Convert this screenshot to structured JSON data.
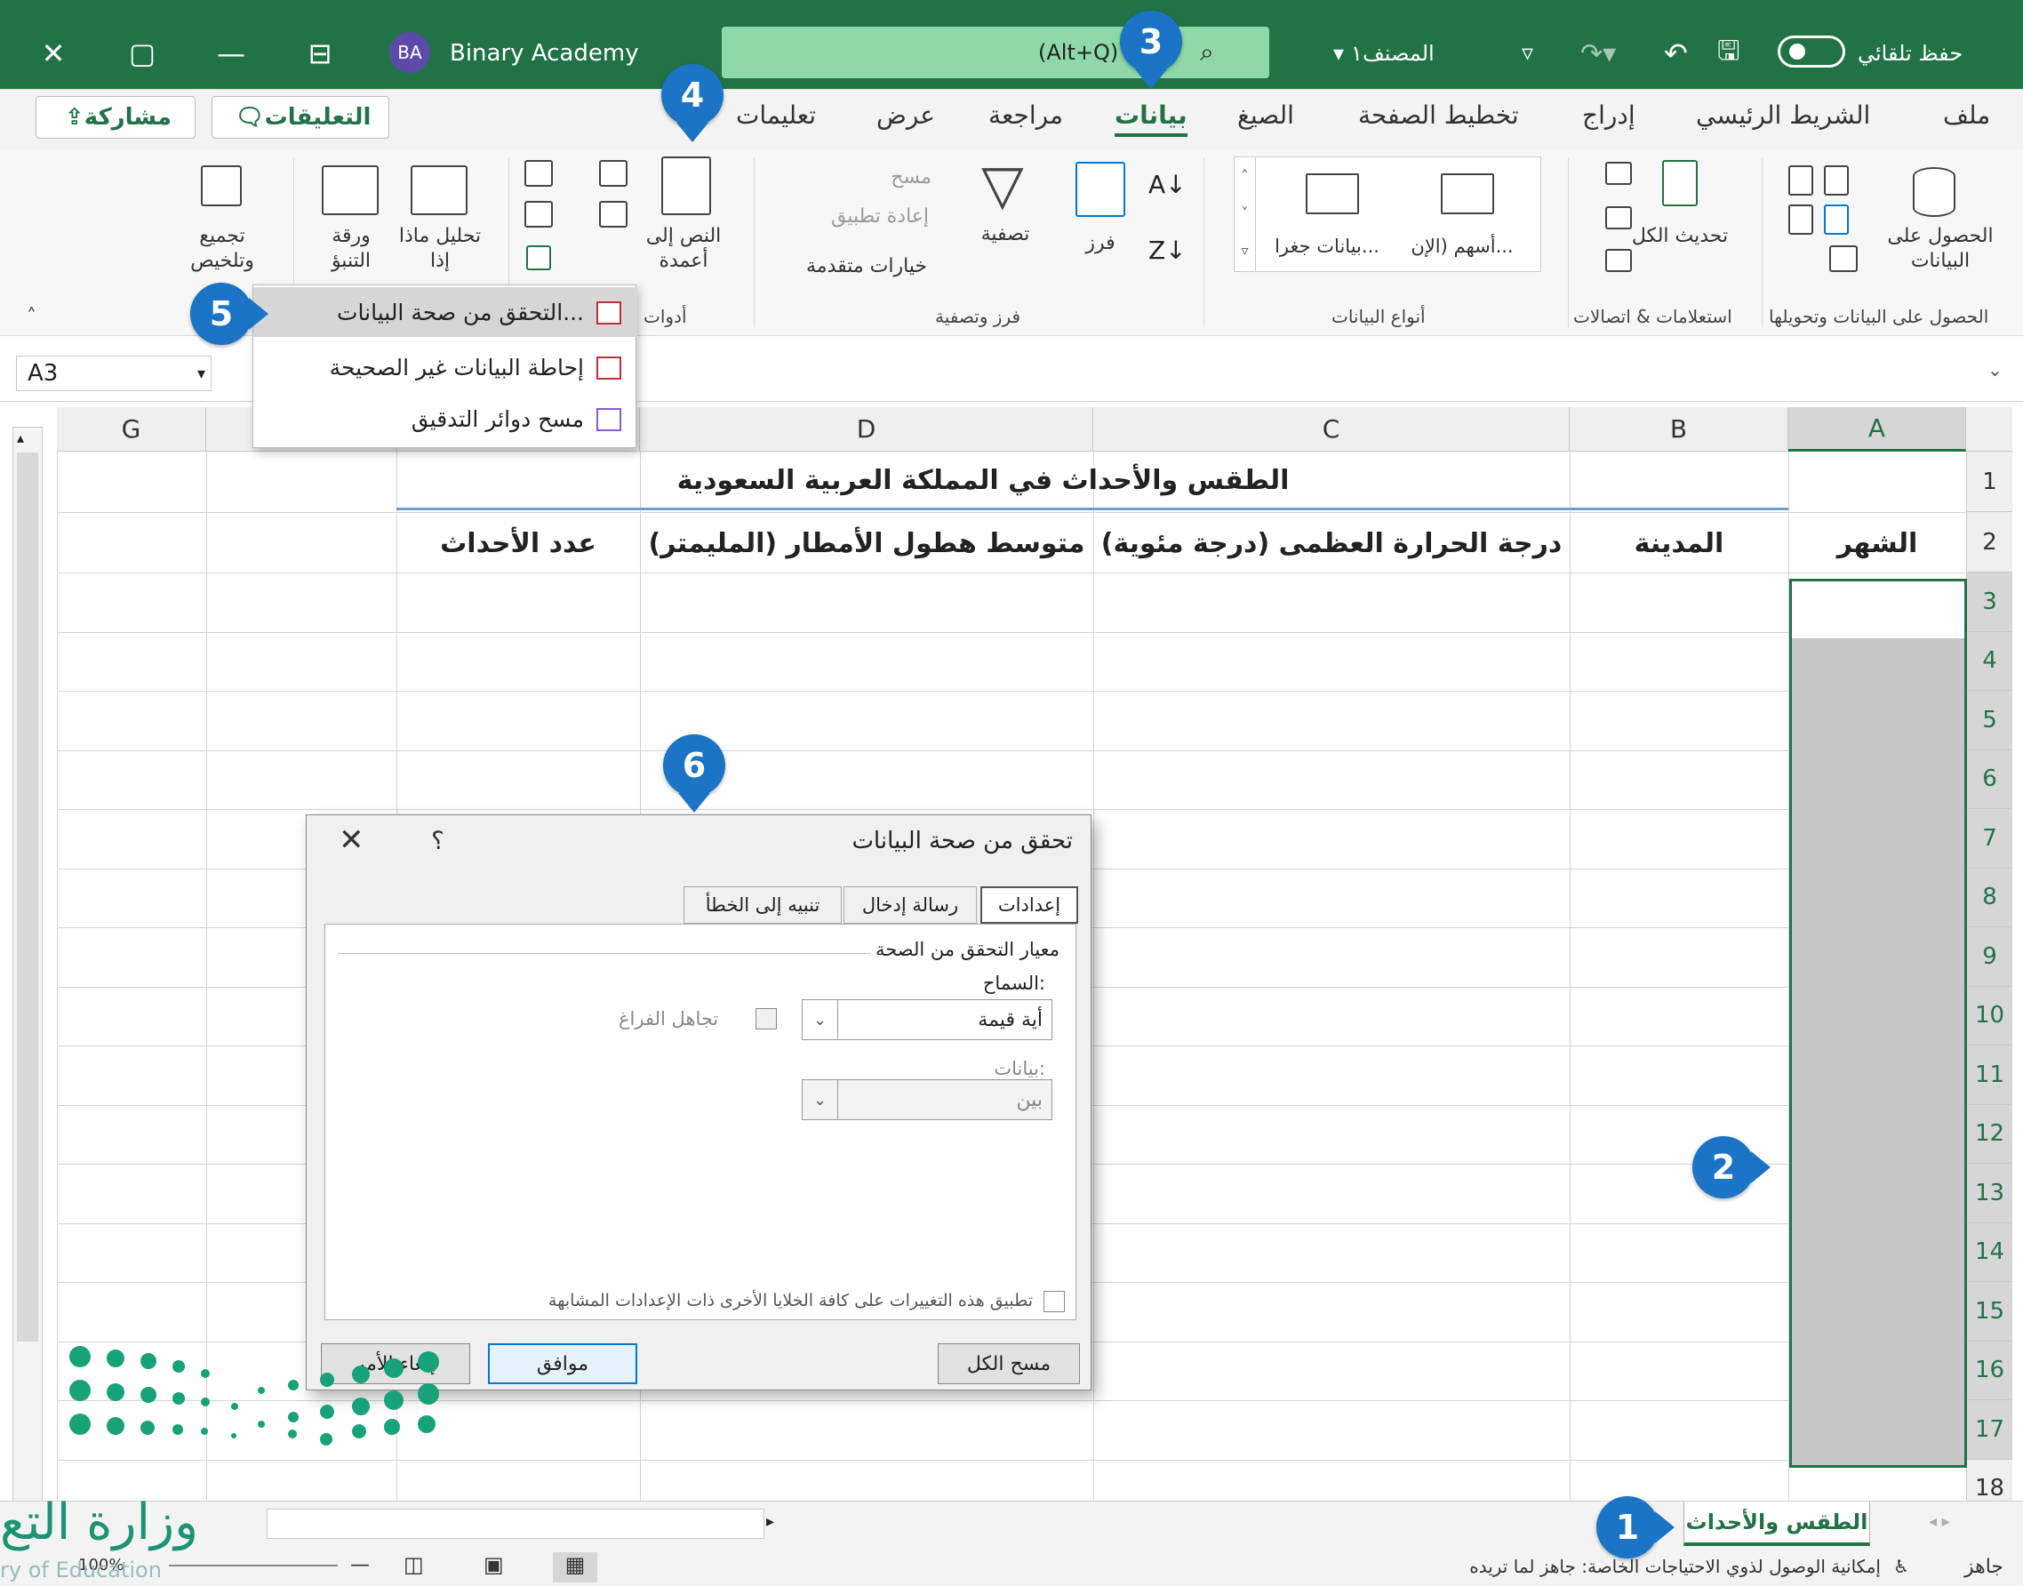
{
  "titlebar": {
    "autosave_label": "حفظ تلقائي",
    "file_name": "المصنف١",
    "search_shortcut": "(Alt+Q)",
    "account_initials": "BA",
    "account_name": "Binary Academy"
  },
  "tabs": [
    {
      "label": "ملف"
    },
    {
      "label": "الشريط الرئيسي"
    },
    {
      "label": "إدراج"
    },
    {
      "label": "تخطيط الصفحة"
    },
    {
      "label": "الصيغ"
    },
    {
      "label": "بيانات"
    },
    {
      "label": "مراجعة"
    },
    {
      "label": "عرض"
    },
    {
      "label": "تعليمات"
    }
  ],
  "comments_label": "التعليقات",
  "share_label": "مشاركة",
  "ribbon": {
    "get_data": "الحصول على البيانات",
    "refresh_all": "تحديث الكل",
    "stocks": "أسهم (الإن...",
    "geography": "بيانات جغرا...",
    "sort": "فرز",
    "filter": "تصفية",
    "clear": "مسح",
    "reapply": "إعادة تطبيق",
    "advanced": "خيارات متقدمة",
    "text_to_columns": "النص إلى أعمدة",
    "what_if": "تحليل ماذا إذا",
    "forecast_sheet": "ورقة التنبؤ",
    "outline": "تجميع وتلخيص",
    "groups": {
      "get_transform": "الحصول على البيانات وتحويلها",
      "queries": "استعلامات & اتصالات",
      "data_types": "أنواع البيانات",
      "sort_filter": "فرز وتصفية",
      "tools": "أدوات"
    }
  },
  "dropdown": {
    "items": [
      {
        "label": "التحقق من صحة البيانات..."
      },
      {
        "label": "إحاطة البيانات غير الصحيحة"
      },
      {
        "label": "مسح دوائر التدقيق"
      }
    ]
  },
  "namebox": "A3",
  "grid": {
    "columns": [
      "A",
      "B",
      "C",
      "D",
      "",
      "",
      "G"
    ],
    "rows": [
      "1",
      "2",
      "3",
      "4",
      "5",
      "6",
      "7",
      "8",
      "9",
      "10",
      "11",
      "12",
      "13",
      "14",
      "15",
      "16",
      "17",
      "18"
    ],
    "title": "الطقس والأحداث في المملكة العربية السعودية",
    "headers": {
      "a": "الشهر",
      "b": "المدينة",
      "c": "درجة الحرارة العظمى (درجة مئوية)",
      "d": "متوسط هطول الأمطار (المليمتر)",
      "e": "عدد الأحداث"
    }
  },
  "dialog": {
    "title": "تحقق من صحة البيانات",
    "help": "؟",
    "tabs": [
      "إعدادات",
      "رسالة إدخال",
      "تنبيه إلى الخطأ"
    ],
    "criteria": "معيار التحقق من الصحة",
    "allow_label": "السماح:",
    "allow_value": "أية قيمة",
    "ignore_blank": "تجاهل الفراغ",
    "data_label": "بيانات:",
    "data_value": "بين",
    "apply_all": "تطبيق هذه التغييرات على كافة الخلايا الأخرى ذات الإعدادات المشابهة",
    "clear_all": "مسح الكل",
    "ok": "موافق",
    "cancel": "إلغاء الأمر"
  },
  "sheet_tab": "الطقس والأحداث",
  "status": {
    "ready": "جاهز",
    "accessibility": "إمكانية الوصول لذوي الاحتياجات الخاصة: جاهز لما تريده",
    "zoom": "100%"
  },
  "callouts": [
    "1",
    "2",
    "3",
    "4",
    "5",
    "6"
  ],
  "watermark": {
    "text_ar": "وزارة التع",
    "text_en": "ry of Education"
  },
  "colors": {
    "excel_green": "#217346",
    "callout_blue": "#1c74c6",
    "selection_gray": "#c6c6c6"
  }
}
